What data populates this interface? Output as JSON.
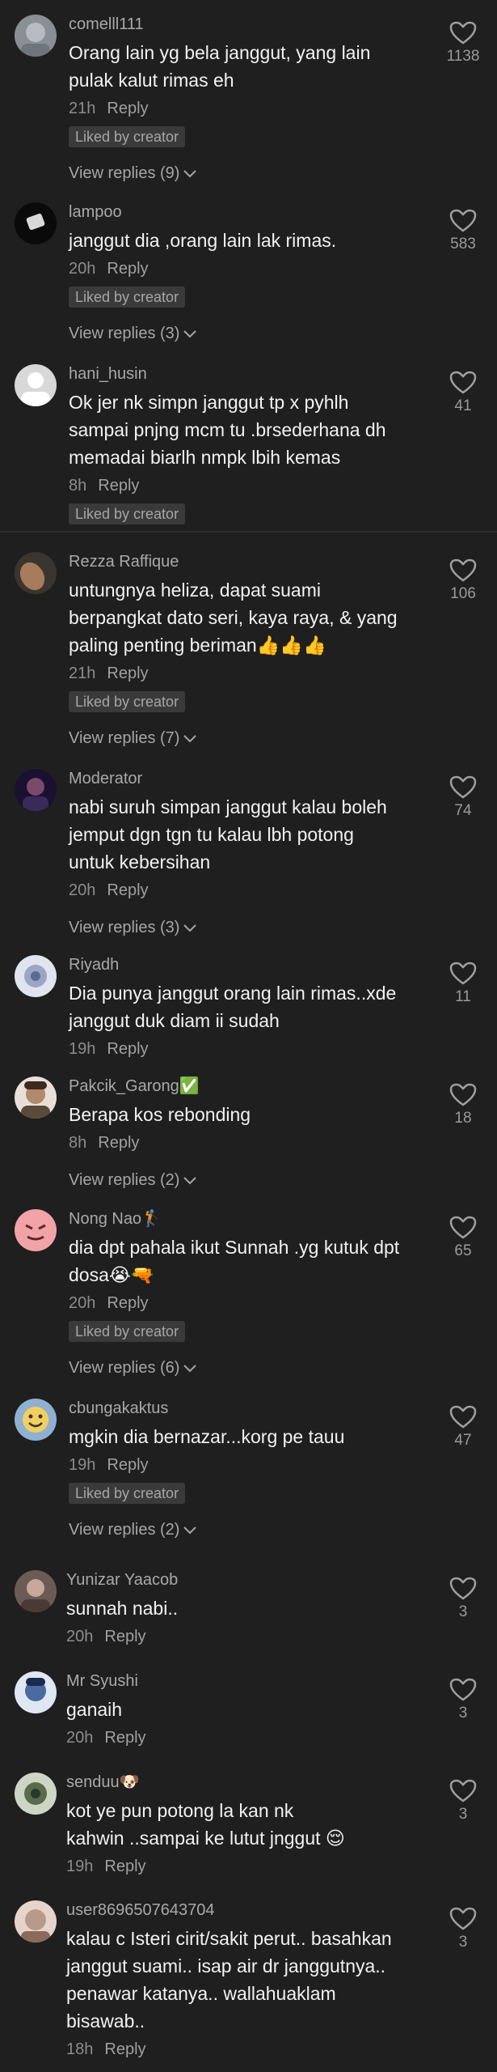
{
  "comments": [
    {
      "username": "comelll111",
      "text": "Orang lain yg bela janggut, yang lain\npulak kalut rimas eh",
      "time": "21h",
      "reply": "Reply",
      "liked_by_creator": "Liked by creator",
      "view_replies": "View replies (9)",
      "likes": "1138",
      "avatar_color": "#8a8f96"
    },
    {
      "username": "lampoo",
      "text": "janggut dia ,orang lain lak rimas.",
      "time": "20h",
      "reply": "Reply",
      "liked_by_creator": "Liked by creator",
      "view_replies": "View replies (3)",
      "likes": "583",
      "avatar_color": "#0a0a0a"
    },
    {
      "username": "hani_husin",
      "text": "Ok jer nk simpn janggut tp x pyhlh\nsampai pnjng mcm tu .brsederhana dh\nmemadai biarlh nmpk lbih kemas",
      "time": "8h",
      "reply": "Reply",
      "liked_by_creator": "Liked by creator",
      "likes": "41",
      "avatar_color": "#d8d8d8"
    },
    {
      "username": "Rezza Raffique",
      "text": "untungnya heliza, dapat suami\nberpangkat dato seri, kaya raya, & yang\npaling penting beriman👍👍👍",
      "time": "21h",
      "reply": "Reply",
      "liked_by_creator": "Liked by creator",
      "view_replies": "View replies (7)",
      "likes": "106",
      "avatar_color": "#6d5a45"
    },
    {
      "username": "Moderator",
      "text": "nabi suruh simpan janggut kalau boleh\njemput dgn tgn tu kalau lbh potong\nuntuk kebersihan",
      "time": "20h",
      "reply": "Reply",
      "view_replies": "View replies (3)",
      "likes": "74",
      "avatar_color": "#3a2a5a"
    },
    {
      "username": "Riyadh",
      "text": "Dia punya janggut orang lain rimas..xde\njanggut duk diam ii sudah",
      "time": "19h",
      "reply": "Reply",
      "likes": "11",
      "avatar_color": "#9aa6c4"
    },
    {
      "username": "Pakcik_Garong✅",
      "text": "Berapa kos rebonding",
      "time": "8h",
      "reply": "Reply",
      "view_replies": "View replies (2)",
      "likes": "18",
      "avatar_color": "#7a6a5a"
    },
    {
      "username": "Nong Nao🏌",
      "text": "dia dpt pahala ikut Sunnah .yg kutuk dpt\ndosa😭🔫",
      "time": "20h",
      "reply": "Reply",
      "liked_by_creator": "Liked by creator",
      "view_replies": "View replies (6)",
      "likes": "65",
      "avatar_color": "#f2a3a8"
    },
    {
      "username": "cbungakaktus",
      "text": "mgkin dia bernazar...korg pe tauu",
      "time": "19h",
      "reply": "Reply",
      "liked_by_creator": "Liked by creator",
      "view_replies": "View replies (2)",
      "likes": "47",
      "avatar_color": "#8fb0d0"
    },
    {
      "username": "Yunizar Yaacob",
      "text": "sunnah nabi..",
      "time": "20h",
      "reply": "Reply",
      "likes": "3",
      "avatar_color": "#6b5b55"
    },
    {
      "username": "Mr Syushi",
      "text": "ganaih",
      "time": "20h",
      "reply": "Reply",
      "likes": "3",
      "avatar_color": "#4a6aa0"
    },
    {
      "username": "senduu🐶",
      "text": "kot ye pun potong la kan nk\nkahwin ..sampai ke lutut jnggut 😌",
      "time": "19h",
      "reply": "Reply",
      "likes": "3",
      "avatar_color": "#5a6a4a"
    },
    {
      "username": "user8696507643704",
      "text": "kalau c Isteri cirit/sakit perut.. basahkan\njanggut suami.. isap air dr janggutnya..\npenawar katanya.. wallahuaklam\nbisawab..",
      "time": "18h",
      "reply": "Reply",
      "likes": "3",
      "avatar_color": "#b89a8a"
    }
  ],
  "icons": {
    "like": "heart-outline-icon",
    "chevron": "chevron-down-icon"
  },
  "colors": {
    "background": "#1f1f1f",
    "liked_badge_bg": "#3a3a3a",
    "secondary_text": "#a9a9a9"
  }
}
